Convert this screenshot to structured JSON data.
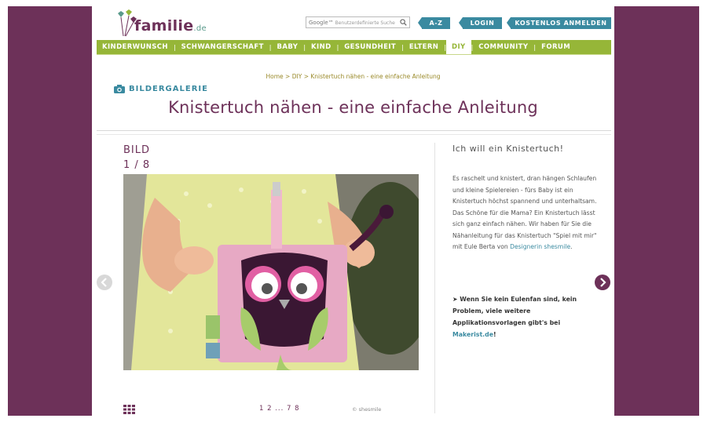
{
  "site": {
    "logo_name": "familie",
    "logo_tld": ".de"
  },
  "search": {
    "google": "Google™",
    "placeholder": "Benutzerdefinierte Suche"
  },
  "header_buttons": {
    "az": "A-Z",
    "login": "LOGIN",
    "signup": "KOSTENLOS ANMELDEN"
  },
  "nav": {
    "items": [
      {
        "label": "KINDERWUNSCH"
      },
      {
        "label": "SCHWANGERSCHAFT"
      },
      {
        "label": "BABY"
      },
      {
        "label": "KIND"
      },
      {
        "label": "GESUNDHEIT"
      },
      {
        "label": "ELTERN"
      },
      {
        "label": "DIY"
      },
      {
        "label": "COMMUNITY"
      },
      {
        "label": "FORUM"
      }
    ],
    "active": "DIY",
    "separator": "|"
  },
  "breadcrumb": {
    "home": "Home",
    "sep": ">",
    "diy": "DIY",
    "current": "Knistertuch nähen - eine einfache Anleitung"
  },
  "gallery_label": "BILDERGALERIE",
  "title": "Knistertuch nähen - eine einfache Anleitung",
  "image_counter": {
    "label": "BILD",
    "position": "1 / 8"
  },
  "sidebar": {
    "title": "Ich will ein Knistertuch!",
    "body_pre": "Es raschelt und knistert, dran hängen Schlaufen und kleine Spielereien - fürs Baby ist ein Knistertuch höchst spannend und unterhaltsam. Das Schöne für die Mama? Ein Knistertuch lässt sich ganz einfach nähen. Wir haben für Sie die Nähanleitung für das Knistertuch \"Spiel mit mir\" mit Eule Berta von ",
    "body_link": "Designerin shesmile",
    "body_post": ".",
    "cta_arrow": "➤",
    "cta_text": " Wenn Sie kein Eulenfan sind, kein Problem, viele weitere Applikationsvorlagen gibt's bei ",
    "cta_link": "Makerist.de",
    "cta_end": "!"
  },
  "pager": {
    "text": "1 2 ... 7 8"
  },
  "credit": "© shesmile",
  "colors": {
    "brand": "#6d3159",
    "accent": "#3a8aa0",
    "nav": "#96b638"
  }
}
